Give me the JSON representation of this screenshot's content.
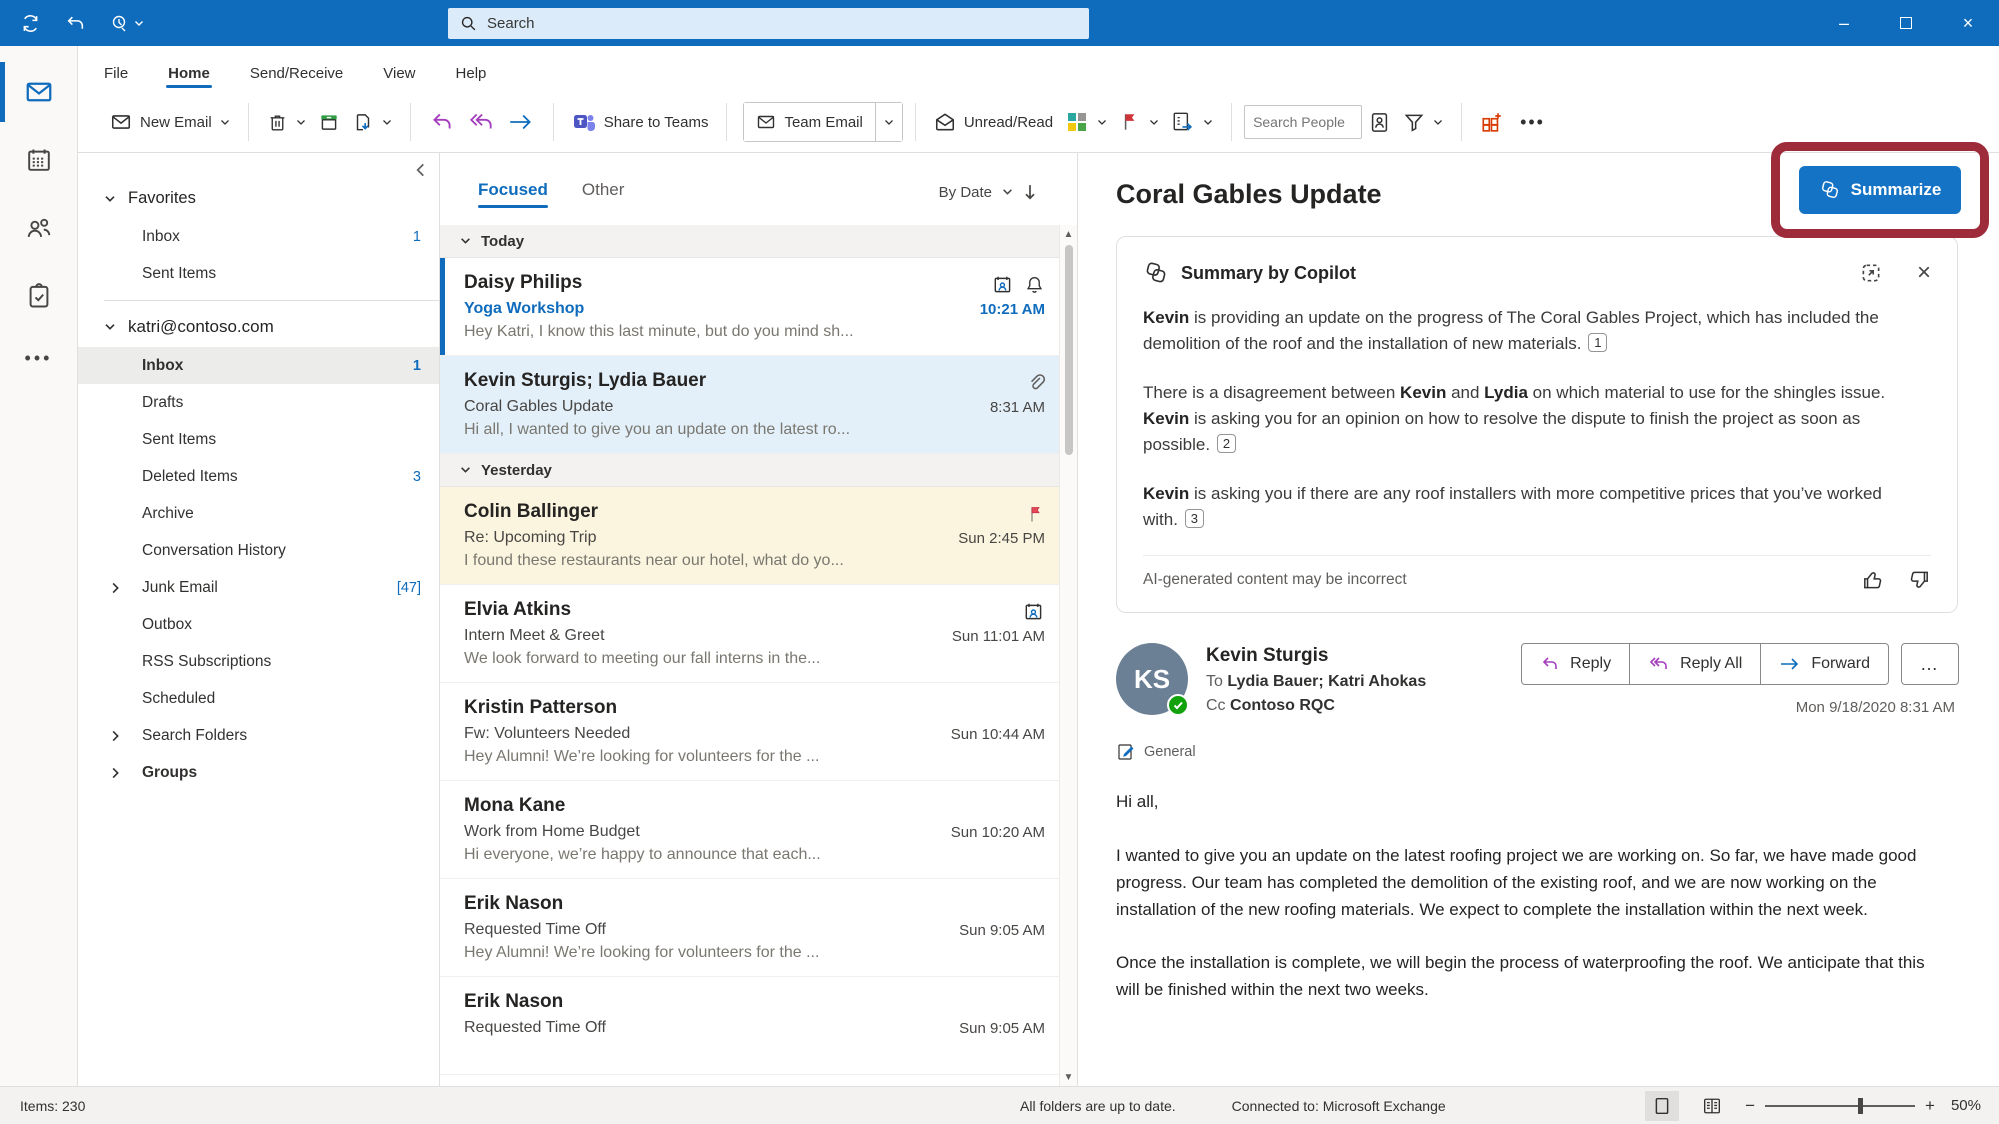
{
  "colors": {
    "accent": "#0f6cbd",
    "annotation_red": "#9e2b3a",
    "summarize_blue": "#1473c4",
    "flag_red": "#d13438"
  },
  "titlebar": {
    "search_placeholder": "Search"
  },
  "ribbon": {
    "tabs": [
      {
        "label": "File"
      },
      {
        "label": "Home"
      },
      {
        "label": "Send/Receive"
      },
      {
        "label": "View"
      },
      {
        "label": "Help"
      }
    ],
    "active_tab": "Home",
    "new_email": "New Email",
    "share_to_teams": "Share to Teams",
    "team_email": "Team Email",
    "unread_read": "Unread/Read",
    "search_people_placeholder": "Search People",
    "overflow": "•••"
  },
  "folders": {
    "favorites_header": "Favorites",
    "favorites": [
      {
        "label": "Inbox",
        "count": "1"
      },
      {
        "label": "Sent Items",
        "count": ""
      }
    ],
    "account_header": "katri@contoso.com",
    "items": [
      {
        "label": "Inbox",
        "count": "1"
      },
      {
        "label": "Drafts",
        "count": ""
      },
      {
        "label": "Sent Items",
        "count": ""
      },
      {
        "label": "Deleted Items",
        "count": "3"
      },
      {
        "label": "Archive",
        "count": ""
      },
      {
        "label": "Conversation History",
        "count": ""
      },
      {
        "label": "Junk Email",
        "count": "[47]"
      },
      {
        "label": "Outbox",
        "count": ""
      },
      {
        "label": "RSS Subscriptions",
        "count": ""
      },
      {
        "label": "Scheduled",
        "count": ""
      },
      {
        "label": "Search Folders",
        "count": ""
      },
      {
        "label": "Groups",
        "count": ""
      }
    ]
  },
  "message_list": {
    "tab_focused": "Focused",
    "tab_other": "Other",
    "sort_label": "By Date",
    "group_today": "Today",
    "group_yesterday": "Yesterday",
    "emails": [
      {
        "sender": "Daisy Philips",
        "subject": "Yoga Workshop",
        "preview": "Hey Katri, I know this last minute, but do you mind sh...",
        "time": "10:21 AM"
      },
      {
        "sender": "Kevin Sturgis; Lydia Bauer",
        "subject": "Coral Gables Update",
        "preview": "Hi all, I wanted to give you an update on the latest ro...",
        "time": "8:31 AM"
      },
      {
        "sender": "Colin Ballinger",
        "subject": "Re: Upcoming Trip",
        "preview": "I found these restaurants near our hotel, what do yo...",
        "time": "Sun 2:45 PM"
      },
      {
        "sender": "Elvia Atkins",
        "subject": "Intern Meet & Greet",
        "preview": "We look forward to meeting our fall interns in the...",
        "time": "Sun 11:01 AM"
      },
      {
        "sender": "Kristin Patterson",
        "subject": "Fw: Volunteers Needed",
        "preview": "Hey Alumni! We’re looking for volunteers for the ...",
        "time": "Sun 10:44 AM"
      },
      {
        "sender": "Mona Kane",
        "subject": "Work from Home Budget",
        "preview": "Hi everyone, we’re happy to announce that each...",
        "time": "Sun 10:20 AM"
      },
      {
        "sender": "Erik Nason",
        "subject": "Requested Time Off",
        "preview": "Hey Alumni! We’re looking for volunteers for the ...",
        "time": "Sun 9:05 AM"
      },
      {
        "sender": "Erik Nason",
        "subject": "Requested Time Off",
        "preview": "",
        "time": "Sun 9:05 AM"
      }
    ]
  },
  "reading_pane": {
    "subject": "Coral Gables Update",
    "summarize_label": "Summarize",
    "card": {
      "title": "Summary by Copilot",
      "p1": [
        {
          "b": "Kevin"
        },
        {
          "t": " is providing an update on the progress of The Coral Gables Project, which has included the demolition of the roof and the installation of new materials. "
        },
        {
          "c": "1"
        }
      ],
      "p2": [
        {
          "t": "There is a disagreement between "
        },
        {
          "b": "Kevin"
        },
        {
          "t": " and "
        },
        {
          "b": "Lydia"
        },
        {
          "t": " on which material to use for the shingles issue. "
        },
        {
          "b": "Kevin"
        },
        {
          "t": " is asking you for an opinion on how to resolve the dispute to finish the project as soon as possible. "
        },
        {
          "c": "2"
        }
      ],
      "p3": [
        {
          "b": "Kevin"
        },
        {
          "t": " is asking you if there are any roof installers with more competitive prices that you’ve worked\nwith. "
        },
        {
          "c": "3"
        }
      ],
      "disclaimer": "AI-generated content may be incorrect"
    },
    "message": {
      "sender": "Kevin Sturgis",
      "avatar_initials": "KS",
      "to_label": "To",
      "to_names": "Lydia Bauer; Katri Ahokas",
      "cc_label": "Cc",
      "cc_names": "Contoso RQC",
      "reply": "Reply",
      "reply_all": "Reply All",
      "forward": "Forward",
      "more": "…",
      "date": "Mon 9/18/2020 8:31 AM",
      "sensitivity_label": "General",
      "body": [
        "Hi all,",
        "I wanted to give you an update on the latest roofing project we are working on. So far, we have made good progress. Our team has completed the demolition of the existing roof, and we are now working on the installation of the new roofing materials. We expect to complete the installation within the next week.",
        "Once the installation is complete, we will begin the process of waterproofing the roof. We anticipate that this will be finished within the next two weeks."
      ]
    }
  },
  "status_bar": {
    "items": "Items: 230",
    "sync": "All folders are up to date.",
    "connection": "Connected to: Microsoft Exchange",
    "zoom": "50%"
  }
}
